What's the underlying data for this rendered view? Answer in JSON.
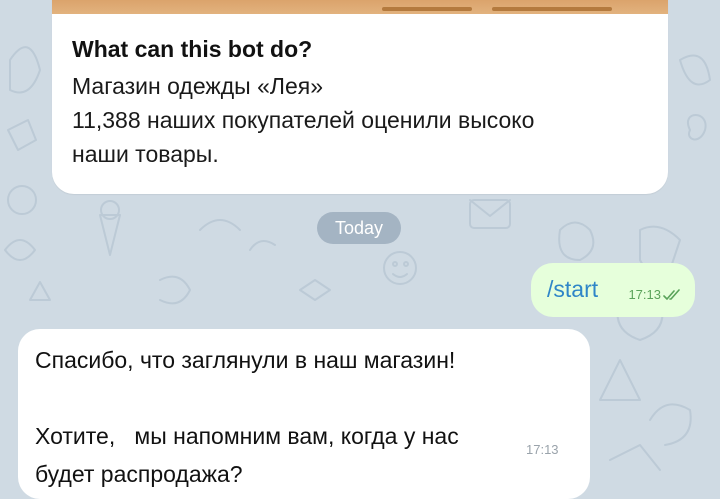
{
  "bot_info": {
    "title": "What can this bot do?",
    "lines": [
      "Магазин одежды «Лея»",
      "11,388 наших покупателей оценили высоко",
      "наши товары."
    ]
  },
  "date_separator": "Today",
  "outgoing_message": {
    "text": "/start",
    "time": "17:13",
    "status_icon": "double-check-icon"
  },
  "incoming_message": {
    "lines": [
      "Спасибо, что заглянули в наш магазин!",
      "Хотите,   мы напомним вам, когда у нас",
      "будет распродажа?"
    ],
    "time": "17:13"
  },
  "colors": {
    "chat_background": "#cfdae3",
    "outgoing_bubble": "#e6ffdb",
    "command_link": "#2f86c8",
    "read_check": "#5aa35a"
  }
}
